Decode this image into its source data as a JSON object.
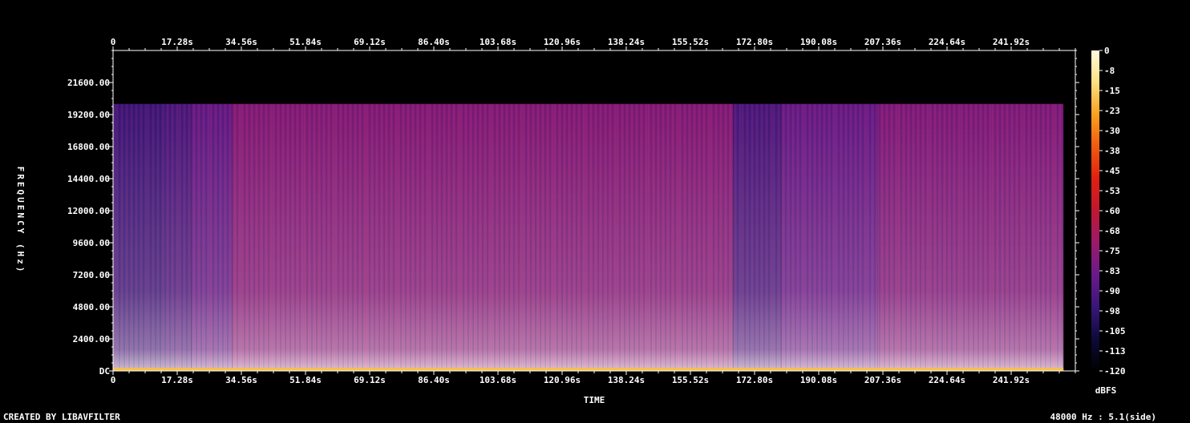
{
  "chart_data": {
    "type": "heatmap",
    "xlabel": "TIME",
    "ylabel": "FREQUENCY (Hz)",
    "x_ticks": [
      "0",
      "17.28s",
      "34.56s",
      "51.84s",
      "69.12s",
      "86.40s",
      "103.68s",
      "120.96s",
      "138.24s",
      "155.52s",
      "172.80s",
      "190.08s",
      "207.36s",
      "224.64s",
      "241.92s"
    ],
    "x_tick_values": [
      0,
      17.28,
      34.56,
      51.84,
      69.12,
      86.4,
      103.68,
      120.96,
      138.24,
      155.52,
      172.8,
      190.08,
      207.36,
      224.64,
      241.92
    ],
    "xlim": [
      0,
      259.2
    ],
    "y_ticks": [
      "DC",
      "2400.00",
      "4800.00",
      "7200.00",
      "9600.00",
      "12000.00",
      "14400.00",
      "16800.00",
      "19200.00",
      "21600.00"
    ],
    "y_tick_values": [
      0,
      2400,
      4800,
      7200,
      9600,
      12000,
      14400,
      16800,
      19200,
      21600
    ],
    "ylim": [
      0,
      24000
    ],
    "colorbar": {
      "label": "dBFS",
      "ticks": [
        "0",
        "-8",
        "-15",
        "-23",
        "-30",
        "-38",
        "-45",
        "-53",
        "-60",
        "-68",
        "-75",
        "-83",
        "-90",
        "-98",
        "-105",
        "-113",
        "-120"
      ],
      "tick_values": [
        0,
        -7.5,
        -15,
        -22.5,
        -30,
        -37.5,
        -45,
        -52.5,
        -60,
        -67.5,
        -75,
        -82.5,
        -90,
        -97.5,
        -105,
        -112.5,
        -120
      ],
      "range": [
        -120,
        0
      ]
    },
    "spectral_cutoff_hz": 20000,
    "audio_end_s": 256,
    "segments": [
      {
        "start": 0,
        "end": 13.5,
        "level_db": -95
      },
      {
        "start": 13.5,
        "end": 21,
        "level_db": -92
      },
      {
        "start": 21,
        "end": 32,
        "level_db": -86
      },
      {
        "start": 32,
        "end": 167,
        "level_db": -78
      },
      {
        "start": 167,
        "end": 180,
        "level_db": -92
      },
      {
        "start": 180,
        "end": 206,
        "level_db": -85
      },
      {
        "start": 206,
        "end": 256,
        "level_db": -79
      }
    ],
    "colormap": [
      "#000000",
      "#0d0a3a",
      "#3a167a",
      "#6a1a8a",
      "#9a1a6a",
      "#c01830",
      "#e02010",
      "#f05a10",
      "#f8a020",
      "#fde080",
      "#fffbe0"
    ]
  },
  "footer": {
    "left": "CREATED BY LIBAVFILTER",
    "right": "48000 Hz : 5.1(side)"
  }
}
